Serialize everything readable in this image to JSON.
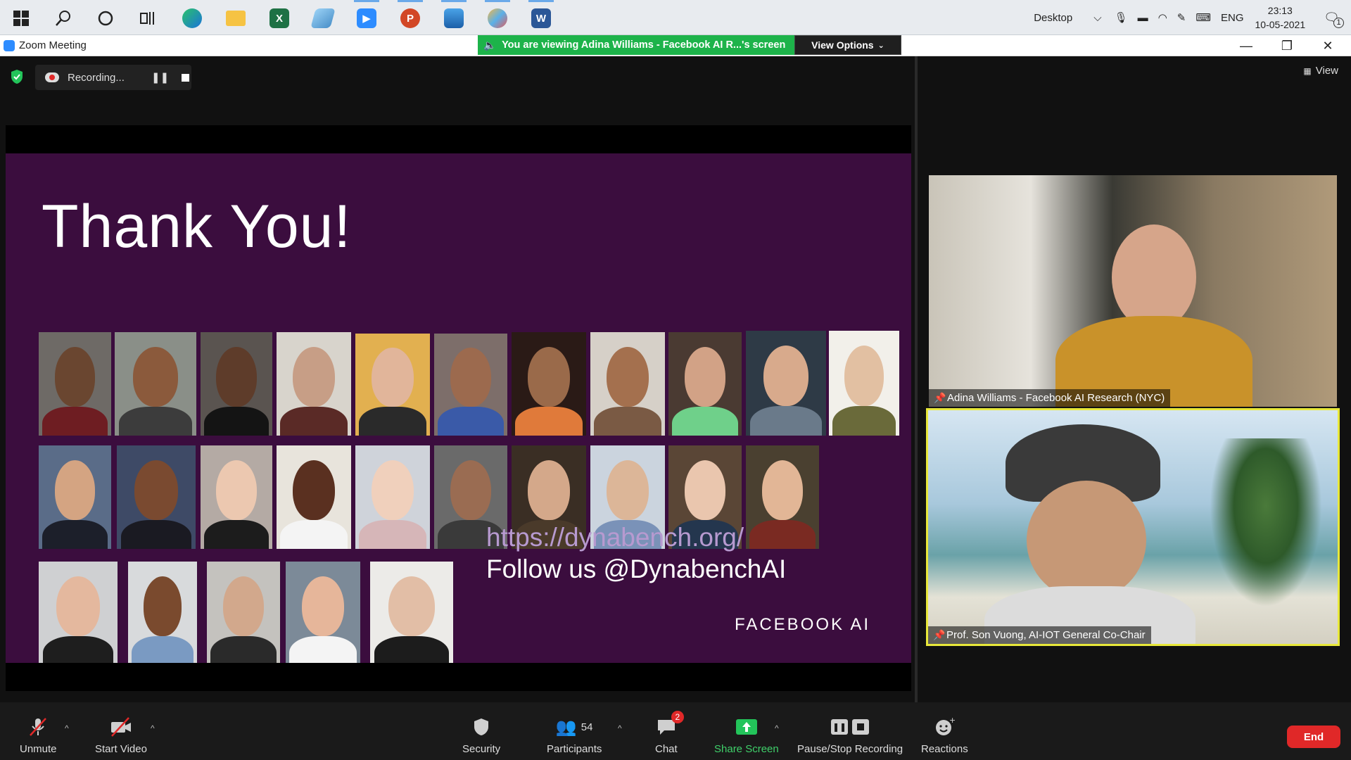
{
  "taskbar": {
    "desktop_label": "Desktop",
    "lang": "ENG",
    "time": "23:13",
    "date": "10-05-2021",
    "notification_count": "1",
    "icons": [
      "windows-start-icon",
      "search-icon",
      "cortana-icon",
      "task-view-icon",
      "edge-icon",
      "file-explorer-icon",
      "excel-icon",
      "app-icon",
      "zoom-icon",
      "powerpoint-icon",
      "photos-icon",
      "paint-icon",
      "word-icon"
    ]
  },
  "window": {
    "title": "Zoom Meeting",
    "viewing_banner": "You are viewing Adina Williams - Facebook AI R...'s screen",
    "view_options": "View Options"
  },
  "meeting": {
    "recording_label": "Recording...",
    "view_label": "View"
  },
  "slide": {
    "title": "Thank You!",
    "url": "https://dynabench.org/",
    "follow": "Follow us @DynabenchAI",
    "brand": "FACEBOOK AI"
  },
  "participants_video": [
    {
      "name": "Adina Williams - Facebook AI Research (NYC)"
    },
    {
      "name": "Prof. Son Vuong, AI-IOT General Co-Chair"
    }
  ],
  "toolbar": {
    "unmute": "Unmute",
    "start_video": "Start Video",
    "security": "Security",
    "participants": "Participants",
    "participants_count": "54",
    "chat": "Chat",
    "chat_badge": "2",
    "share_screen": "Share Screen",
    "pause_stop": "Pause/Stop Recording",
    "reactions": "Reactions",
    "end": "End"
  },
  "colors": {
    "slide_bg": "#3b0d3e",
    "share_green": "#1db34a",
    "end_red": "#e02828",
    "active_speaker": "#e8e83a"
  }
}
